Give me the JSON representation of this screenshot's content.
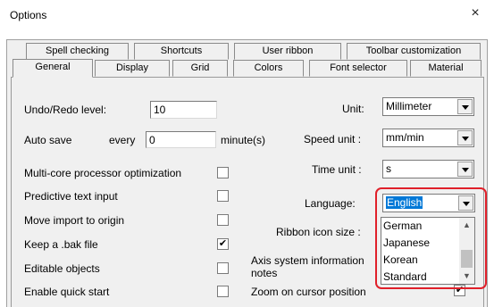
{
  "window": {
    "title": "Options",
    "close_glyph": "×"
  },
  "tabs_row1": [
    "Spell checking",
    "Shortcuts",
    "User ribbon",
    "Toolbar customization"
  ],
  "tabs_row2": [
    "General",
    "Display",
    "Grid",
    "Colors",
    "Font selector",
    "Material"
  ],
  "active_tab": "General",
  "left": {
    "undo_label": "Undo/Redo level:",
    "undo_value": "10",
    "autosave_label": "Auto save",
    "autosave_every": "every",
    "autosave_value": "0",
    "autosave_unit": "minute(s)",
    "options": [
      {
        "label": "Multi-core processor optimization",
        "checked": false
      },
      {
        "label": "Predictive text input",
        "checked": false
      },
      {
        "label": "Move import to origin",
        "checked": false
      },
      {
        "label": "Keep a .bak file",
        "checked": true
      },
      {
        "label": "Editable objects",
        "checked": false
      },
      {
        "label": "Enable quick start",
        "checked": false
      }
    ]
  },
  "right": {
    "unit_label": "Unit:",
    "unit_value": "Millimeter",
    "speed_label": "Speed unit :",
    "speed_value": "mm/min",
    "time_label": "Time unit :",
    "time_value": "s",
    "language_label": "Language:",
    "language_value": "English",
    "language_options": [
      "German",
      "Japanese",
      "Korean",
      "Standard"
    ],
    "ribbon_label": "Ribbon icon size :",
    "axis_label_1": "Axis system information ",
    "axis_label_2": "notes",
    "zoom_label": "Zoom on cursor position",
    "zoom_checked": true
  },
  "colors": {
    "highlight": "#e0202a",
    "selection": "#0078d7"
  }
}
